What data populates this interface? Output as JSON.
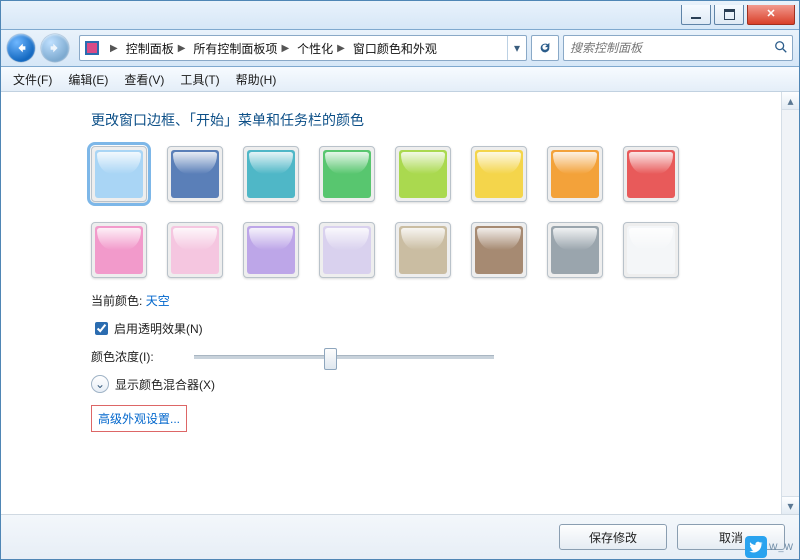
{
  "titlebar": {},
  "breadcrumb": {
    "items": [
      "控制面板",
      "所有控制面板项",
      "个性化",
      "窗口颜色和外观"
    ]
  },
  "search": {
    "placeholder": "搜索控制面板"
  },
  "menu": {
    "file": "文件(F)",
    "edit": "编辑(E)",
    "view": "查看(V)",
    "tools": "工具(T)",
    "help": "帮助(H)"
  },
  "heading": "更改窗口边框、「开始」菜单和任务栏的颜色",
  "colors": [
    {
      "name": "sky",
      "hex": "#a9d5f5",
      "selected": true
    },
    {
      "name": "dusk",
      "hex": "#5a7fb8"
    },
    {
      "name": "sea",
      "hex": "#4fb7c7"
    },
    {
      "name": "leaf",
      "hex": "#58c66f"
    },
    {
      "name": "lime",
      "hex": "#aad94f"
    },
    {
      "name": "sun",
      "hex": "#f4d54b"
    },
    {
      "name": "pumpkin",
      "hex": "#f3a23a"
    },
    {
      "name": "ruby",
      "hex": "#e85a5a"
    },
    {
      "name": "fuchsia",
      "hex": "#f29acb"
    },
    {
      "name": "blush",
      "hex": "#f5c6e0"
    },
    {
      "name": "violet",
      "hex": "#bda6e8"
    },
    {
      "name": "lavender",
      "hex": "#d9d1ee"
    },
    {
      "name": "taupe",
      "hex": "#cabda2"
    },
    {
      "name": "chocolate",
      "hex": "#a68a72"
    },
    {
      "name": "slate",
      "hex": "#9aa5ad"
    },
    {
      "name": "frost",
      "hex": "#f4f6f8"
    }
  ],
  "current_color_label": "当前颜色:",
  "current_color_value": "天空",
  "transparency_label": "启用透明效果(N)",
  "transparency_checked": true,
  "intensity_label": "颜色浓度(I):",
  "mixer_label": "显示颜色混合器(X)",
  "advanced_link": "高级外观设置...",
  "buttons": {
    "save": "保存修改",
    "cancel": "取消"
  },
  "watermark": "W_W"
}
